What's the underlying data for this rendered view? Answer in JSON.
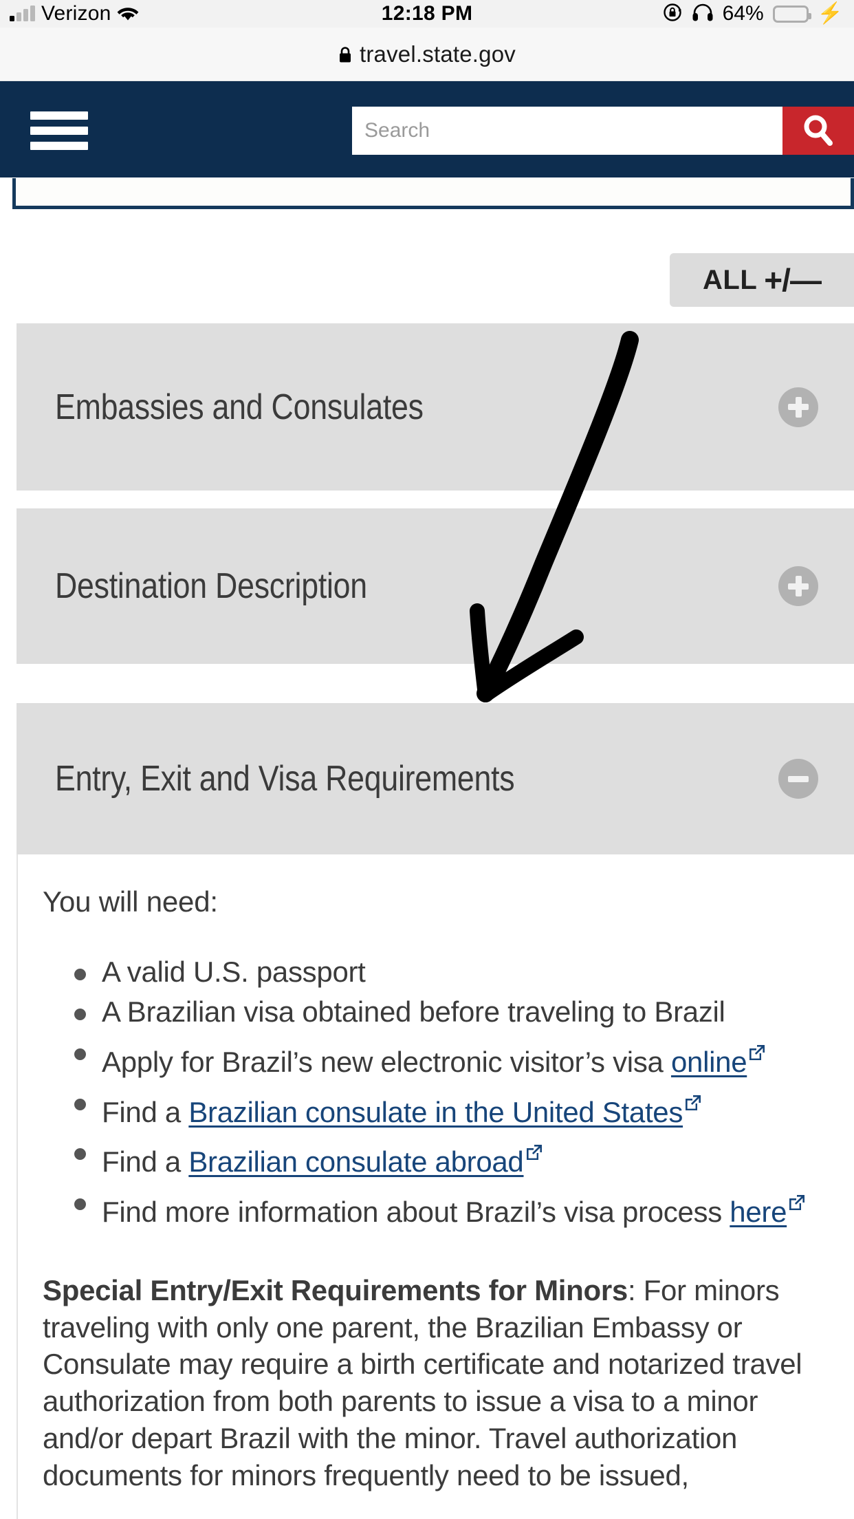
{
  "statusbar": {
    "carrier": "Verizon",
    "time": "12:18 PM",
    "battery_pct": "64%",
    "wifi_icon": "wifi-icon",
    "signal_icon": "cellular-signal-icon",
    "rotation_lock_icon": "rotation-lock-icon",
    "headphones_icon": "headphones-icon",
    "battery_icon": "battery-icon",
    "charging_icon": "charging-bolt-icon",
    "battery_color": "#4cd964"
  },
  "browser": {
    "url": "travel.state.gov",
    "lock_icon": "lock-icon"
  },
  "site_header": {
    "menu_icon": "hamburger-menu-icon",
    "search_placeholder": "Search",
    "search_value": "",
    "search_icon": "search-icon",
    "background": "#0d2d4f",
    "search_button_color": "#c8262c"
  },
  "controls": {
    "expand_all_label": "ALL",
    "expand_all_symbols": "+/—"
  },
  "accordions": [
    {
      "title": "Embassies and Consulates",
      "state": "collapsed",
      "icon": "plus-icon"
    },
    {
      "title": "Destination Description",
      "state": "collapsed",
      "icon": "plus-icon"
    },
    {
      "title": "Entry, Exit and Visa Requirements",
      "state": "expanded",
      "icon": "minus-icon"
    }
  ],
  "panel": {
    "lead": "You will need:",
    "bullets": [
      {
        "before": "A valid U.S. passport",
        "link": "",
        "after": "",
        "external": false
      },
      {
        "before": "A Brazilian visa obtained before traveling to Brazil",
        "link": "",
        "after": "",
        "external": false
      },
      {
        "before": "Apply for Brazil’s new electronic visitor’s visa ",
        "link": "online",
        "after": "",
        "external": true
      },
      {
        "before": "Find a ",
        "link": "Brazilian consulate in the United States",
        "after": "",
        "external": true
      },
      {
        "before": "Find a ",
        "link": "Brazilian consulate abroad",
        "after": "",
        "external": true
      },
      {
        "before": "Find more information about Brazil’s visa process ",
        "link": "here",
        "after": "",
        "external": true
      }
    ],
    "paragraph_bold": "Special Entry/Exit Requirements for Minors",
    "paragraph_rest": ": For minors traveling with only one parent, the Brazilian Embassy or Consulate may require a birth certificate and notarized travel authorization from both parents to issue a visa to a minor and/or depart Brazil with the minor. Travel authorization documents for minors frequently need to be issued,",
    "link_color": "#17457a",
    "external_link_icon": "external-link-icon"
  },
  "annotation": {
    "type": "hand-drawn-arrow",
    "name": "annotation-arrow",
    "color": "#000000",
    "points_to": "Entry, Exit and Visa Requirements"
  }
}
